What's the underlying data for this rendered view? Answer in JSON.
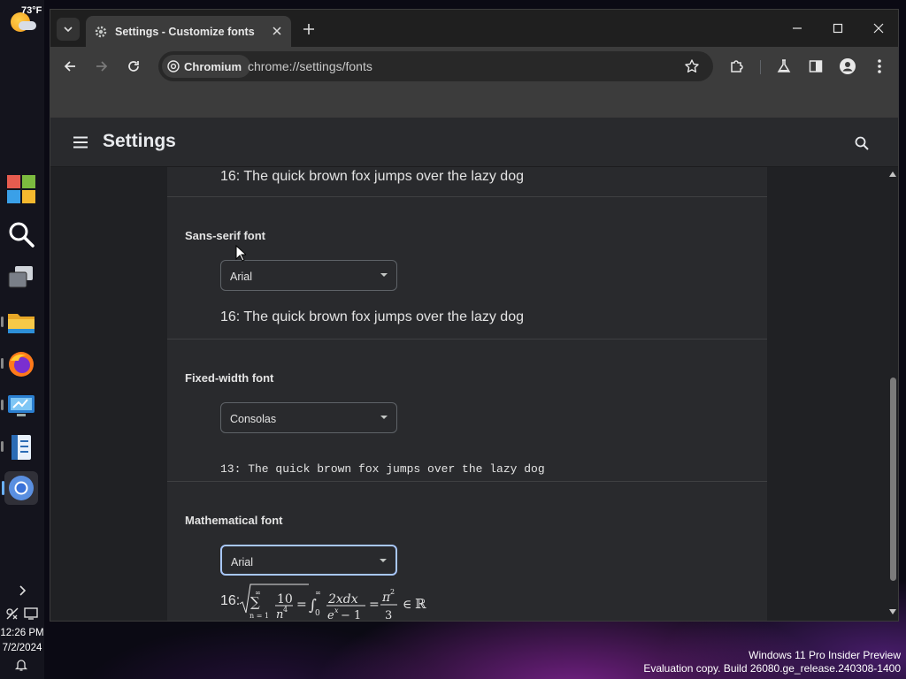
{
  "taskbar": {
    "weather_temp": "73°F",
    "apps": [
      "start",
      "search",
      "task-view",
      "file-explorer",
      "firefox",
      "remote-desktop",
      "notepad",
      "chromium"
    ],
    "clock_time": "12:26 PM",
    "clock_date": "7/2/2024"
  },
  "browser": {
    "tab_title": "Settings - Customize fonts",
    "site_chip": "Chromium",
    "url": "chrome://settings/fonts"
  },
  "settings": {
    "title": "Settings",
    "top_sample": "16: The quick brown fox jumps over the lazy dog",
    "sections": {
      "sans_serif": {
        "label": "Sans-serif font",
        "selected": "Arial",
        "sample": "16: The quick brown fox jumps over the lazy dog"
      },
      "fixed_width": {
        "label": "Fixed-width font",
        "selected": "Consolas",
        "sample": "13: The quick brown fox jumps over the lazy dog"
      },
      "math": {
        "label": "Mathematical font",
        "selected": "Arial",
        "sample_prefix": "16:"
      }
    }
  },
  "watermark": {
    "line1": "Windows 11 Pro Insider Preview",
    "line2": "Evaluation copy. Build 26080.ge_release.240308-1400"
  },
  "colors": {
    "accent": "#a8c7fa",
    "window_bg": "#202124",
    "card_bg": "#292a2d",
    "toolbar_bg": "#3c3c3c"
  }
}
